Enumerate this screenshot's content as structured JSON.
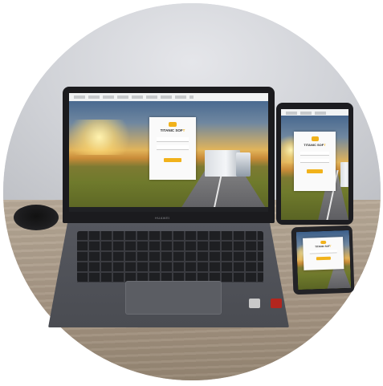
{
  "scene": {
    "subject": "",
    "laptop_brand": "HUAWEI"
  },
  "login": {
    "brand_main": "TITANIC SOF",
    "brand_accent": "T"
  },
  "colors": {
    "accent": "#f1b21b",
    "wall": "#d3d5da",
    "desk": "#a89886",
    "laptop": "#4a4c52"
  }
}
